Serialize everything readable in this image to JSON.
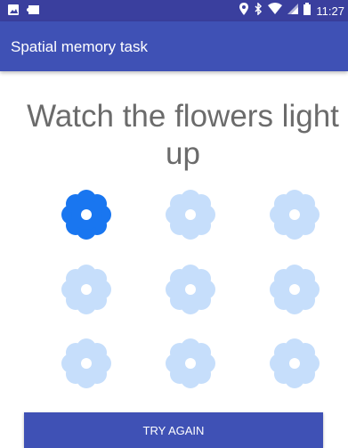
{
  "status_bar": {
    "time": "11:27",
    "left_icons": [
      "image-icon",
      "cast-icon"
    ],
    "right_icons": [
      "location-icon",
      "bluetooth-icon",
      "wifi-icon",
      "signal-icon",
      "battery-icon"
    ]
  },
  "app_bar": {
    "title": "Spatial memory task"
  },
  "main": {
    "instruction": "Watch the flowers light up",
    "flowers": [
      {
        "state": "lit"
      },
      {
        "state": "dim"
      },
      {
        "state": "dim"
      },
      {
        "state": "dim"
      },
      {
        "state": "dim"
      },
      {
        "state": "dim"
      },
      {
        "state": "dim"
      },
      {
        "state": "dim"
      },
      {
        "state": "dim"
      }
    ],
    "try_again_label": "TRY AGAIN"
  },
  "colors": {
    "status_bar": "#3a3f9e",
    "app_bar": "#3f51b5",
    "flower_lit": "#1976f0",
    "flower_dim": "#c6defb",
    "button": "#3f51b5"
  }
}
